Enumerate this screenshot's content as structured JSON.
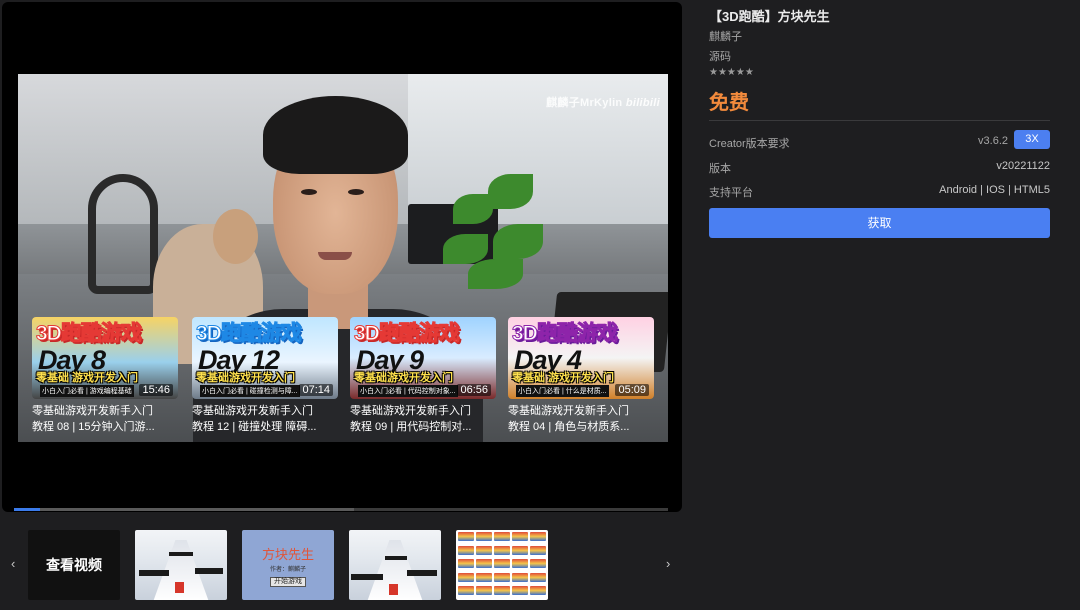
{
  "player": {
    "watermark_text": "麒麟子MrKylin",
    "watermark_logo": "bilibili",
    "progress_fraction": 0.04,
    "buffer_fraction": 0.52,
    "end_cards": [
      {
        "thumb_title": "3D跑酷游戏",
        "thumb_day": "Day 8",
        "thumb_banner": "零基础 游戏开发入门",
        "thumb_sub": "小白入门必看 | 游戏编程基础",
        "duration": "15:46",
        "caption_line1": "零基础游戏开发新手入门",
        "caption_line2": "教程 08 | 15分钟入门游..."
      },
      {
        "thumb_title": "3D跑酷游戏",
        "thumb_day": "Day 12",
        "thumb_banner": "零基础游戏开发入门",
        "thumb_sub": "小白入门必看 | 碰撞检测与障...",
        "duration": "07:14",
        "caption_line1": "零基础游戏开发新手入门",
        "caption_line2": "教程 12 | 碰撞处理 障碍..."
      },
      {
        "thumb_title": "3D跑酷游戏",
        "thumb_day": "Day 9",
        "thumb_banner": "零基础游戏开发入门",
        "thumb_sub": "小白入门必看 | 代码控制对象...",
        "duration": "06:56",
        "caption_line1": "零基础游戏开发新手入门",
        "caption_line2": "教程 09 | 用代码控制对..."
      },
      {
        "thumb_title": "3D跑酷游戏",
        "thumb_day": "Day 4",
        "thumb_banner": "零基础 游戏开发入门",
        "thumb_sub": "小白入门必看 | 什么是材质...",
        "duration": "05:09",
        "caption_line1": "零基础游戏开发新手入门",
        "caption_line2": "教程 04 | 角色与材质系..."
      }
    ]
  },
  "info": {
    "title": "【3D跑酷】方块先生",
    "author": "麒麟子",
    "type": "源码",
    "stars": "★★★★★",
    "price": "免费",
    "rows": [
      {
        "label": "Creator版本要求",
        "value": "v3.6.2",
        "badge": "3X"
      },
      {
        "label": "版本",
        "value": "v20221122"
      },
      {
        "label": "支持平台",
        "value": "Android | IOS | HTML5"
      }
    ],
    "get_button": "获取"
  },
  "strip": {
    "prev_arrow": "‹",
    "next_arrow": "›",
    "watch_video": "查看视频",
    "menu_title": "方块先生",
    "menu_author": "作者：麒麟子",
    "menu_start": "开始游戏"
  },
  "colors": {
    "accent": "#4a7ff2",
    "price": "#f28a3c",
    "background": "#1e1e20"
  }
}
